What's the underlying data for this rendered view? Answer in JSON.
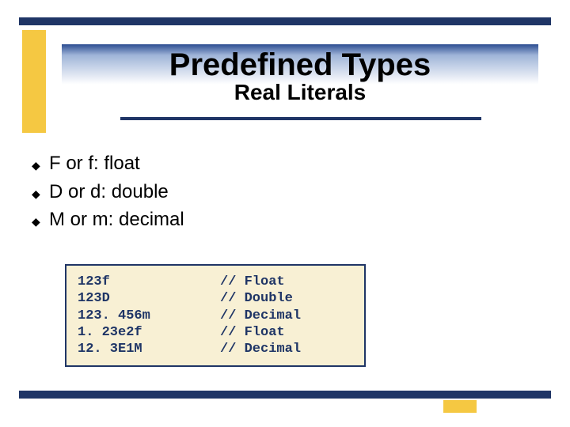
{
  "title": "Predefined Types",
  "subtitle": "Real Literals",
  "bullets": [
    "F or f: float",
    "D or d: double",
    "M or m: decimal"
  ],
  "code": [
    {
      "literal": "123f",
      "comment": "// Float"
    },
    {
      "literal": "123D",
      "comment": "// Double"
    },
    {
      "literal": "123. 456m",
      "comment": "// Decimal"
    },
    {
      "literal": "1. 23e2f",
      "comment": "// Float"
    },
    {
      "literal": "12. 3E1M",
      "comment": "// Decimal"
    }
  ]
}
